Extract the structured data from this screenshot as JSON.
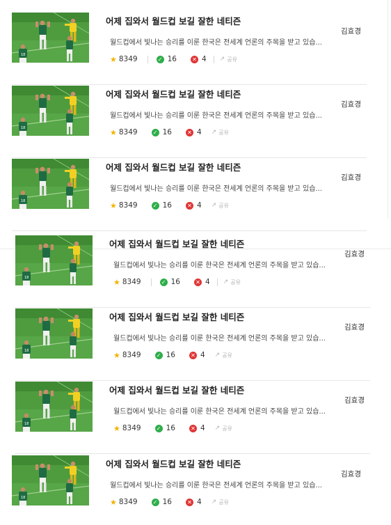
{
  "articles": [
    {
      "title": "어제 집와서 월드컵 보길 잘한 네티즌",
      "summary": "월드컵에서 빛나는 승리를 이룬 한국은 전세계 언론의 주목을 받고 있습...",
      "author": "김효경",
      "stars": "8349",
      "likes": "16",
      "dislikes": "4",
      "share": "공유",
      "show_separator": true
    },
    {
      "title": "어제 집와서 월드컵 보길 잘한 네티즌",
      "summary": "월드컵에서 빛나는 승리를 이룬 한국은 전세계 언론의 주목을 받고 있습...",
      "author": "김효경",
      "stars": "8349",
      "likes": "16",
      "dislikes": "4",
      "share": "공유",
      "show_separator": false
    },
    {
      "title": "어제 집와서 월드컵 보길 잘한 네티즌",
      "summary": "월드컵에서 빛나는 승리를 이룬 한국은 전세계 언론의 주목을 받고 있습...",
      "author": "김효경",
      "stars": "8349",
      "likes": "16",
      "dislikes": "4",
      "share": "공유",
      "show_separator": false
    },
    {
      "title": "어제 집와서 월드컵 보길 잘한 네티즌",
      "summary": "월드컵에서 빛나는 승리를 이룬 한국은 전세계 언론의 주목을 받고 있습...",
      "author": "김효경",
      "stars": "8349",
      "likes": "16",
      "dislikes": "4",
      "share": "공유",
      "show_separator": true
    },
    {
      "title": "어제 집와서 월드컵 보길 잘한 네티즌",
      "summary": "월드컵에서 빛나는 승리를 이룬 한국은 전세계 언론의 주목을 받고 있습...",
      "author": "김효경",
      "stars": "8349",
      "likes": "16",
      "dislikes": "4",
      "share": "공유",
      "show_separator": false
    },
    {
      "title": "어제 집와서 월드컵 보길 잘한 네티즌",
      "summary": "월드컵에서 빛나는 승리를 이룬 한국은 전세계 언론의 주목을 받고 있습...",
      "author": "김효경",
      "stars": "8349",
      "likes": "16",
      "dislikes": "4",
      "share": "공유",
      "show_separator": false
    },
    {
      "title": "어제 집와서 월드컵 보길 잘한 네티즌",
      "summary": "월드컵에서 빛나는 승리를 이룬 한국은 전세계 언론의 주목을 받고 있습...",
      "author": "김효경",
      "stars": "8349",
      "likes": "16",
      "dislikes": "4",
      "share": "공유",
      "show_separator": false
    }
  ],
  "icons": {
    "star": "star-icon",
    "like": "check-circle-icon",
    "dislike": "x-circle-icon",
    "share": "share-arrow-icon",
    "thumbnail": "soccer-players-photo"
  },
  "colors": {
    "star": "#f0b400",
    "like": "#2fae4a",
    "dislike": "#e03535",
    "pitch": "#4a9a3c"
  }
}
